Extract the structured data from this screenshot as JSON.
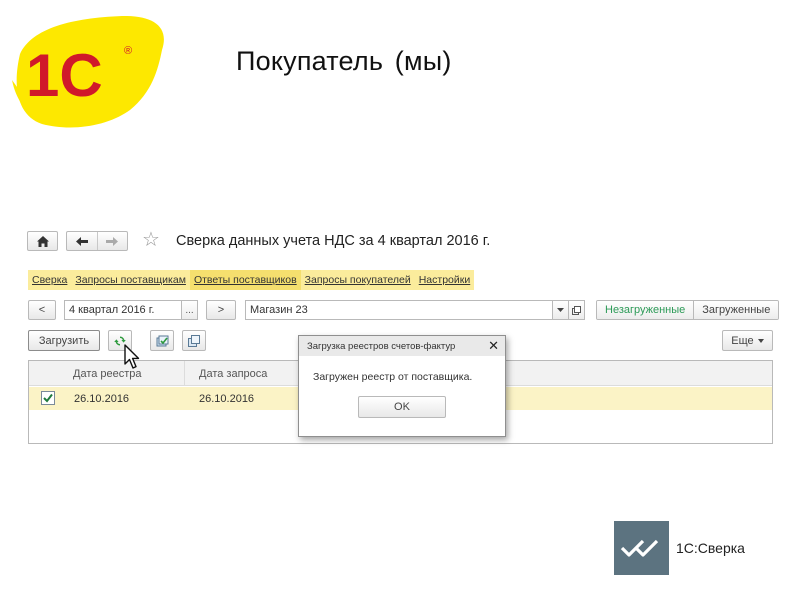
{
  "slide": {
    "logo_text": "1С",
    "logo_registered": "®",
    "title": "Покупатель (мы)",
    "brand_label": "1С:Сверка"
  },
  "colors": {
    "logo_red": "#d0192a",
    "logo_yellow": "#fde800",
    "commandbar_yellow": "#fbec9c",
    "row_highlight": "#fbf3c6",
    "toggle_active": "#2c9a57",
    "brand_tile": "#5c7380"
  },
  "toolbar": {
    "home_icon": "home-icon",
    "back_icon": "arrow-left-icon",
    "forward_icon": "arrow-right-icon",
    "favorite_icon": "star-icon",
    "form_title": "Сверка данных учета НДС за 4 квартал 2016 г."
  },
  "command_bar": {
    "items": [
      {
        "label": "Сверка"
      },
      {
        "label": "Запросы поставщикам"
      },
      {
        "label": "Ответы поставщиков",
        "active": true
      },
      {
        "label": "Запросы покупателей"
      },
      {
        "label": "Настройки"
      }
    ]
  },
  "filters": {
    "prev_label": "<",
    "period_value": "4 квартал 2016 г.",
    "period_select_label": "...",
    "next_label": ">",
    "org_value": "Магазин 23",
    "org_dropdown_icon": "dropdown-arrow-icon",
    "org_open_icon": "open-link-icon",
    "toggle_unloaded": "Незагруженные",
    "toggle_loaded": "Загруженные"
  },
  "actions": {
    "load_label": "Загрузить",
    "refresh_icon": "refresh-icon",
    "export_icon": "export-icon",
    "copy_icon": "copy-icon",
    "more_label": "Еще",
    "more_icon": "dropdown-arrow-icon"
  },
  "grid": {
    "columns": [
      "Дата реестра",
      "Дата запроса"
    ],
    "rows": [
      {
        "checked": true,
        "cells": [
          "26.10.2016",
          "26.10.2016"
        ]
      }
    ]
  },
  "dialog": {
    "title": "Загрузка реестров счетов-фактур",
    "close_label": "✕",
    "message": "Загружен реестр от поставщика.",
    "ok_label": "OK"
  }
}
